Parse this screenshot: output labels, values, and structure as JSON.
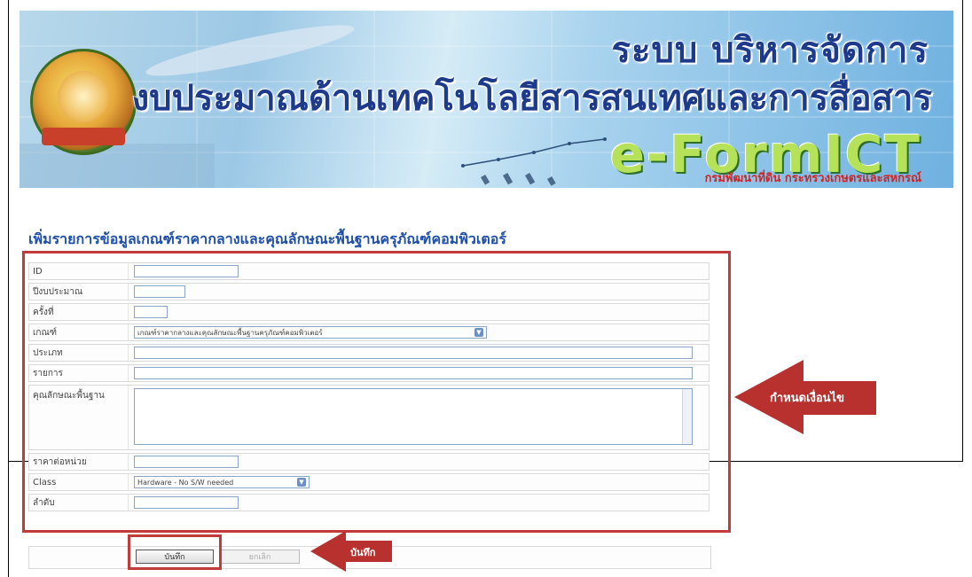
{
  "banner": {
    "title_line1": "ระบบ บริหารจัดการ",
    "title_line2": "งบประมาณด้านเทคโนโลยีสารสนเทศและการสื่อสาร",
    "title_line3": "e-FormICT",
    "title_line4": "กรมพัฒนาที่ดิน กระทรวงเกษตรและสหกรณ์"
  },
  "page_title": "เพิ่มรายการข้อมูลเกณฑ์ราคากลางและคุณลักษณะพื้นฐานครุภัณฑ์คอมพิวเตอร์",
  "form": {
    "fields": [
      {
        "label": "ID",
        "value": ""
      },
      {
        "label": "ปีงบประมาณ",
        "value": ""
      },
      {
        "label": "ครั้งที่",
        "value": ""
      },
      {
        "label": "เกณฑ์",
        "value": "เกณฑ์ราคากลางและคุณลักษณะพื้นฐานครุภัณฑ์คอมพิวเตอร์"
      },
      {
        "label": "ประเภท",
        "value": ""
      },
      {
        "label": "รายการ",
        "value": ""
      },
      {
        "label": "คุณลักษณะพื้นฐาน",
        "value": ""
      },
      {
        "label": "ราคาต่อหน่วย",
        "value": ""
      },
      {
        "label": "Class",
        "value": "Hardware - No S/W needed"
      },
      {
        "label": "ลำดับ",
        "value": ""
      }
    ]
  },
  "buttons": {
    "save": "บันทึก",
    "cancel": "ยกเลิก"
  },
  "annotations": {
    "condition": "กำหนดเงื่อนไข",
    "save": "บันทึก"
  },
  "colors": {
    "annotation_red": "#c23b3b",
    "title_blue": "#1f4fa8"
  }
}
